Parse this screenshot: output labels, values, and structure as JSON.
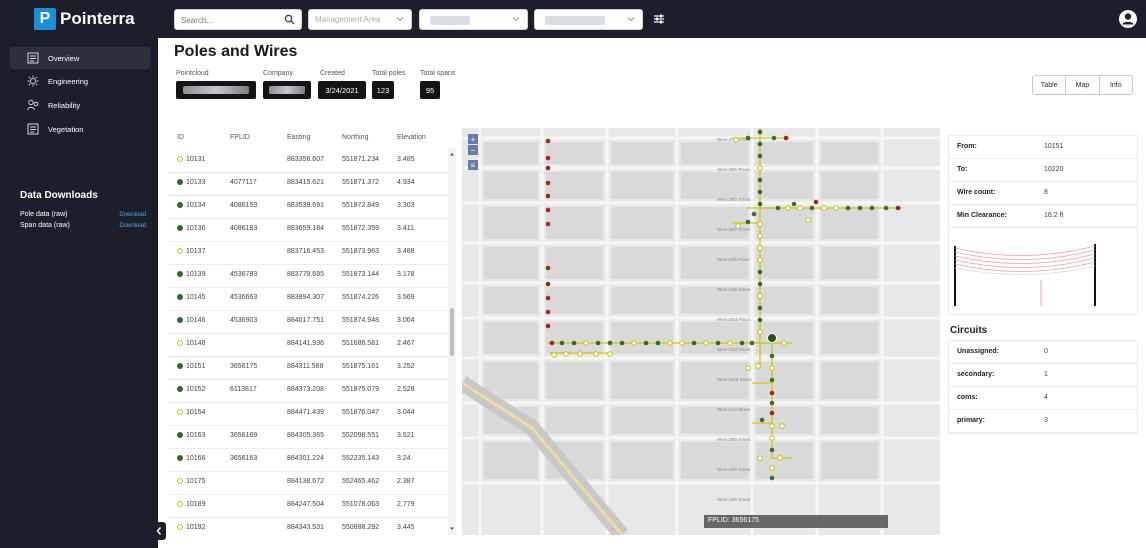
{
  "app": {
    "name": "Pointerra",
    "logo_letter": "P"
  },
  "topbar": {
    "search_placeholder": "Search...",
    "management_area_placeholder": "Management Area"
  },
  "sidebar": {
    "items": [
      {
        "label": "Overview",
        "icon": "overview-icon",
        "active": true
      },
      {
        "label": "Engineering",
        "icon": "engineering-icon",
        "active": false
      },
      {
        "label": "Reliability",
        "icon": "reliability-icon",
        "active": false
      },
      {
        "label": "Vegetation",
        "icon": "vegetation-icon",
        "active": false
      }
    ],
    "downloads": {
      "title": "Data Downloads",
      "rows": [
        {
          "label": "Pole data (raw)",
          "link": "Download"
        },
        {
          "label": "Span data (raw)",
          "link": "Download"
        }
      ]
    }
  },
  "page": {
    "title": "Poles and Wires",
    "stats": {
      "pointcloud_label": "Pointcloud",
      "company_label": "Company",
      "created_label": "Created",
      "created_value": "3/24/2021",
      "total_poles_label": "Total poles",
      "total_poles_value": "123",
      "total_spans_label": "Total spans",
      "total_spans_value": "95"
    },
    "view_buttons": [
      "Table",
      "Map",
      "Info"
    ]
  },
  "table": {
    "columns": [
      "ID",
      "FPLID",
      "Easting",
      "Northing",
      "Elevation"
    ],
    "rows": [
      {
        "id": "10131",
        "fplid": "",
        "easting": "883356.607",
        "northing": "551871.234",
        "elevation": "3.485",
        "filled": false
      },
      {
        "id": "10133",
        "fplid": "4077117",
        "easting": "883415.621",
        "northing": "551871.372",
        "elevation": "4.934",
        "filled": true
      },
      {
        "id": "10134",
        "fplid": "4086153",
        "easting": "883539.691",
        "northing": "551872.849",
        "elevation": "3.303",
        "filled": true
      },
      {
        "id": "10136",
        "fplid": "4086183",
        "easting": "883659.184",
        "northing": "551872.359",
        "elevation": "3.411",
        "filled": true
      },
      {
        "id": "10137",
        "fplid": "",
        "easting": "883716.453",
        "northing": "551873.963",
        "elevation": "3.488",
        "filled": false
      },
      {
        "id": "10139",
        "fplid": "4536783",
        "easting": "883779.685",
        "northing": "551873.144",
        "elevation": "3.178",
        "filled": true
      },
      {
        "id": "10145",
        "fplid": "4536663",
        "easting": "883894.307",
        "northing": "551874.226",
        "elevation": "3.569",
        "filled": true
      },
      {
        "id": "10146",
        "fplid": "4536903",
        "easting": "884017.751",
        "northing": "551874.948",
        "elevation": "3.004",
        "filled": true
      },
      {
        "id": "10148",
        "fplid": "",
        "easting": "884141.936",
        "northing": "551686.581",
        "elevation": "2.467",
        "filled": false
      },
      {
        "id": "10151",
        "fplid": "3656175",
        "easting": "884311.588",
        "northing": "551875.161",
        "elevation": "3.252",
        "filled": true
      },
      {
        "id": "10152",
        "fplid": "6113817",
        "easting": "884373.208",
        "northing": "551875.079",
        "elevation": "2.526",
        "filled": true
      },
      {
        "id": "10154",
        "fplid": "",
        "easting": "884471.439",
        "northing": "551876.047",
        "elevation": "3.044",
        "filled": false
      },
      {
        "id": "10163",
        "fplid": "3656169",
        "easting": "884305.365",
        "northing": "552098.551",
        "elevation": "3.521",
        "filled": true
      },
      {
        "id": "10166",
        "fplid": "3656163",
        "easting": "884301.224",
        "northing": "552235.143",
        "elevation": "3.24",
        "filled": true
      },
      {
        "id": "10175",
        "fplid": "",
        "easting": "884138.672",
        "northing": "552465.462",
        "elevation": "2.387",
        "filled": false
      },
      {
        "id": "10189",
        "fplid": "",
        "easting": "884247.504",
        "northing": "551078.063",
        "elevation": "2.779",
        "filled": false
      },
      {
        "id": "10192",
        "fplid": "",
        "easting": "884343.531",
        "northing": "550888.292",
        "elevation": "3.445",
        "filled": false
      }
    ]
  },
  "map": {
    "tooltip": "FPLID: 3656175",
    "streets": [
      "West 27th Street",
      "West 26th Place",
      "West 26th Street",
      "West 25th Street",
      "West 24th Place",
      "West 24th Street",
      "West 23rd Place",
      "West 23rd Street",
      "West 22nd Street",
      "West 21st Street",
      "West 20th Street",
      "West 19th Street",
      "West 18th Street"
    ],
    "colors": {
      "line": "#d6c21a",
      "pole_green": "#3c6e2f",
      "pole_red": "#a3261c",
      "pole_hollow": "#c9c30e"
    }
  },
  "span_info": {
    "rows": [
      {
        "key": "From:",
        "value": "10151"
      },
      {
        "key": "To:",
        "value": "10220"
      },
      {
        "key": "Wire count:",
        "value": "8"
      },
      {
        "key": "Min Clearance:",
        "value": "16.2 ft"
      }
    ]
  },
  "circuits": {
    "title": "Circuits",
    "rows": [
      {
        "key": "Unassigned:",
        "value": "0"
      },
      {
        "key": "secondary:",
        "value": "1"
      },
      {
        "key": "coms:",
        "value": "4"
      },
      {
        "key": "primary:",
        "value": "3"
      }
    ]
  }
}
